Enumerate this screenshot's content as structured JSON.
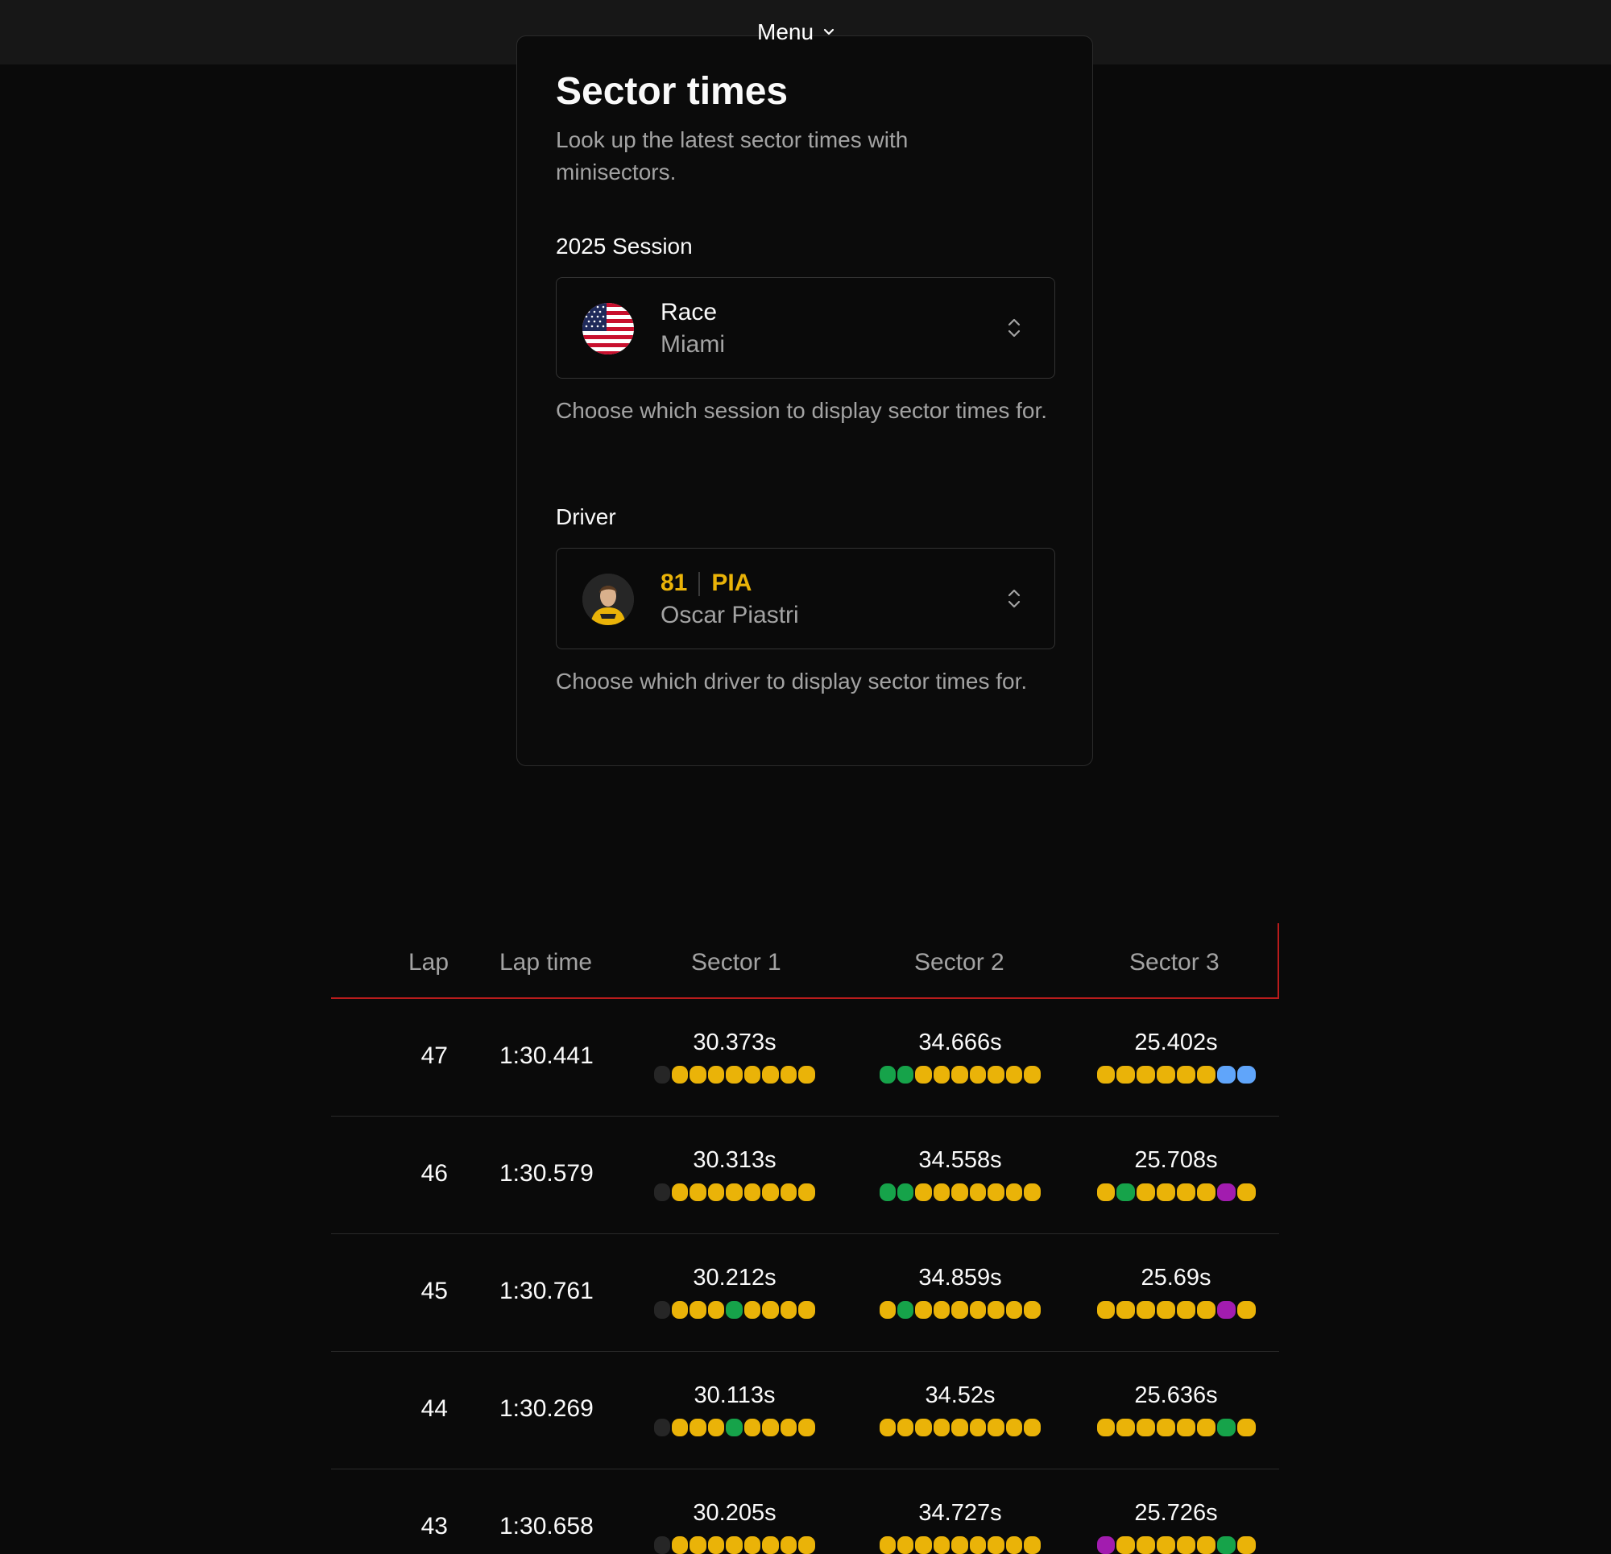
{
  "menu": {
    "label": "Menu"
  },
  "page": {
    "title": "Sector times",
    "subtitle": "Look up the latest sector times with minisectors."
  },
  "session": {
    "label": "2025 Session",
    "name": "Race",
    "location": "Miami",
    "helper": "Choose which session to display sector times for."
  },
  "driver": {
    "label": "Driver",
    "number": "81",
    "abbr": "PIA",
    "name": "Oscar Piastri",
    "helper": "Choose which driver to display sector times for."
  },
  "colors": {
    "grey": "#262626",
    "yellow": "#eab308",
    "green": "#16a34a",
    "purple": "#a21caf",
    "blue": "#60a5fa"
  },
  "table": {
    "headers": {
      "lap": "Lap",
      "lap_time": "Lap time",
      "s1": "Sector 1",
      "s2": "Sector 2",
      "s3": "Sector 3"
    },
    "rows": [
      {
        "lap": "47",
        "time": "1:30.441",
        "s1": "30.373s",
        "s1m": [
          "grey",
          "yellow",
          "yellow",
          "yellow",
          "yellow",
          "yellow",
          "yellow",
          "yellow",
          "yellow"
        ],
        "s2": "34.666s",
        "s2m": [
          "green",
          "green",
          "yellow",
          "yellow",
          "yellow",
          "yellow",
          "yellow",
          "yellow",
          "yellow"
        ],
        "s3": "25.402s",
        "s3m": [
          "yellow",
          "yellow",
          "yellow",
          "yellow",
          "yellow",
          "yellow",
          "blue",
          "blue"
        ]
      },
      {
        "lap": "46",
        "time": "1:30.579",
        "s1": "30.313s",
        "s1m": [
          "grey",
          "yellow",
          "yellow",
          "yellow",
          "yellow",
          "yellow",
          "yellow",
          "yellow",
          "yellow"
        ],
        "s2": "34.558s",
        "s2m": [
          "green",
          "green",
          "yellow",
          "yellow",
          "yellow",
          "yellow",
          "yellow",
          "yellow",
          "yellow"
        ],
        "s3": "25.708s",
        "s3m": [
          "yellow",
          "green",
          "yellow",
          "yellow",
          "yellow",
          "yellow",
          "purple",
          "yellow"
        ]
      },
      {
        "lap": "45",
        "time": "1:30.761",
        "s1": "30.212s",
        "s1m": [
          "grey",
          "yellow",
          "yellow",
          "yellow",
          "green",
          "yellow",
          "yellow",
          "yellow",
          "yellow"
        ],
        "s2": "34.859s",
        "s2m": [
          "yellow",
          "green",
          "yellow",
          "yellow",
          "yellow",
          "yellow",
          "yellow",
          "yellow",
          "yellow"
        ],
        "s3": "25.69s",
        "s3m": [
          "yellow",
          "yellow",
          "yellow",
          "yellow",
          "yellow",
          "yellow",
          "purple",
          "yellow"
        ]
      },
      {
        "lap": "44",
        "time": "1:30.269",
        "s1": "30.113s",
        "s1m": [
          "grey",
          "yellow",
          "yellow",
          "yellow",
          "green",
          "yellow",
          "yellow",
          "yellow",
          "yellow"
        ],
        "s2": "34.52s",
        "s2m": [
          "yellow",
          "yellow",
          "yellow",
          "yellow",
          "yellow",
          "yellow",
          "yellow",
          "yellow",
          "yellow"
        ],
        "s3": "25.636s",
        "s3m": [
          "yellow",
          "yellow",
          "yellow",
          "yellow",
          "yellow",
          "yellow",
          "green",
          "yellow"
        ]
      },
      {
        "lap": "43",
        "time": "1:30.658",
        "s1": "30.205s",
        "s1m": [
          "grey",
          "yellow",
          "yellow",
          "yellow",
          "yellow",
          "yellow",
          "yellow",
          "yellow",
          "yellow"
        ],
        "s2": "34.727s",
        "s2m": [
          "yellow",
          "yellow",
          "yellow",
          "yellow",
          "yellow",
          "yellow",
          "yellow",
          "yellow",
          "yellow"
        ],
        "s3": "25.726s",
        "s3m": [
          "purple",
          "yellow",
          "yellow",
          "yellow",
          "yellow",
          "yellow",
          "green",
          "yellow"
        ]
      }
    ]
  }
}
